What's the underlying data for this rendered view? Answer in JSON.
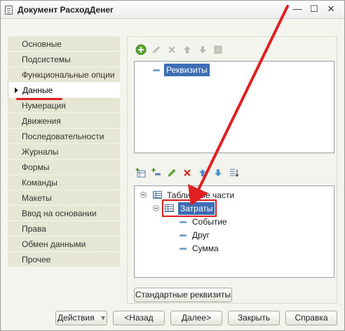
{
  "window": {
    "title": "Документ РасходДенег",
    "minimize_glyph": "—",
    "maximize_glyph": "☐",
    "close_glyph": "✕"
  },
  "sidebar": {
    "items": [
      {
        "label": "Основные"
      },
      {
        "label": "Подсистемы"
      },
      {
        "label": "Функциональные опции"
      },
      {
        "label": "Данные",
        "active": true
      },
      {
        "label": "Нумерация"
      },
      {
        "label": "Движения"
      },
      {
        "label": "Последовательности"
      },
      {
        "label": "Журналы"
      },
      {
        "label": "Формы"
      },
      {
        "label": "Команды"
      },
      {
        "label": "Макеты"
      },
      {
        "label": "Ввод на основании"
      },
      {
        "label": "Права"
      },
      {
        "label": "Обмен данными"
      },
      {
        "label": "Прочее"
      }
    ]
  },
  "attributes": {
    "tree": {
      "root_label": "Реквизиты"
    },
    "toolbar_icons": [
      "add-icon",
      "edit-icon",
      "delete-icon",
      "move-up-icon",
      "move-down-icon",
      "sort-icon"
    ]
  },
  "tabular": {
    "toolbar_icons": [
      "add-table-icon",
      "add-column-icon",
      "edit-icon",
      "delete-icon",
      "move-up-icon",
      "move-down-icon",
      "sort-icon"
    ],
    "tree": {
      "root_label": "Табличные части",
      "table_label": "Затраты",
      "columns": [
        "Событие",
        "Друг",
        "Сумма"
      ]
    },
    "standard_attributes_button": "Стандартные реквизиты"
  },
  "buttons": {
    "actions": "Действия",
    "actions_arrow": "▾",
    "back": "<Назад",
    "next": "Далее>",
    "close": "Закрыть",
    "help": "Справка"
  },
  "colors": {
    "selection": "#3d6db5",
    "annotation_red": "#e02020",
    "sidebar_bg": "#e6e6d4"
  }
}
